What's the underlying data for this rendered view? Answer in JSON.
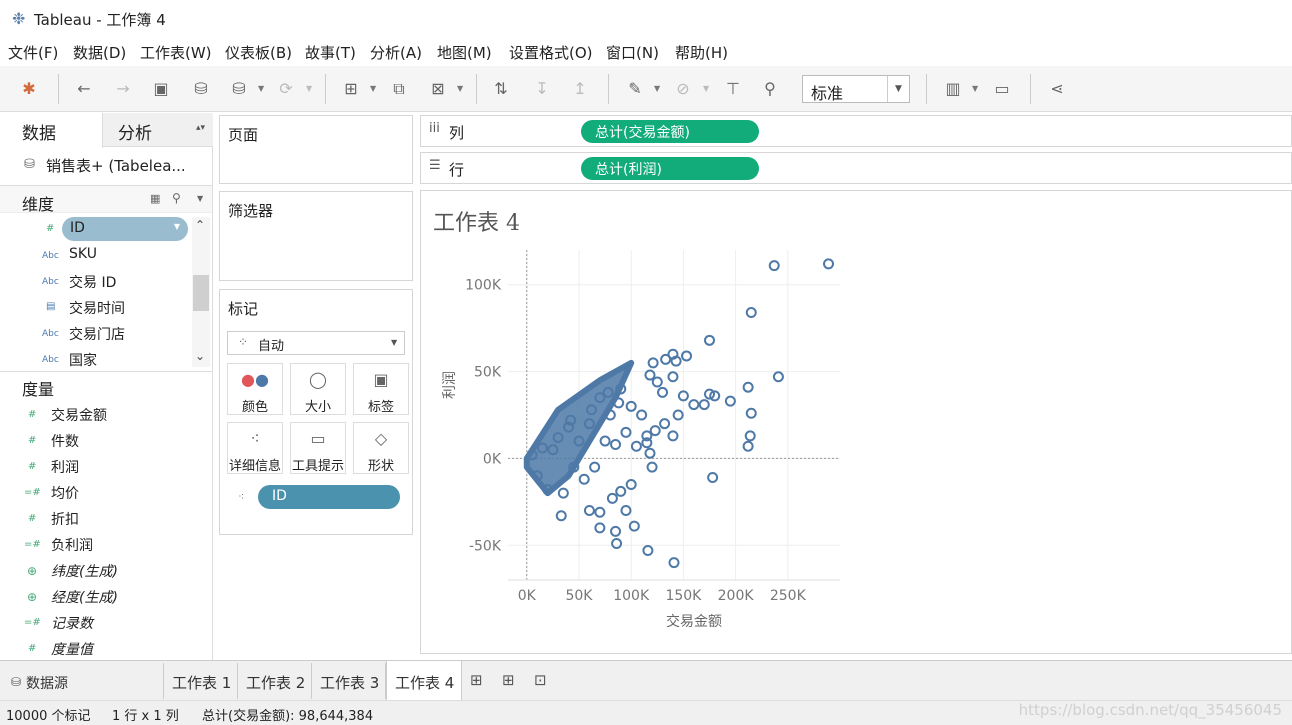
{
  "window": {
    "title": "Tableau - 工作簿 4"
  },
  "menu": [
    "文件(F)",
    "数据(D)",
    "工作表(W)",
    "仪表板(B)",
    "故事(T)",
    "分析(A)",
    "地图(M)",
    "设置格式(O)",
    "窗口(N)",
    "帮助(H)"
  ],
  "toolbar": {
    "icons": [
      "tableau-logo-icon",
      "undo-icon",
      "redo-icon",
      "save-icon",
      "new-datasource-icon",
      "pause-updates-icon",
      "refresh-icon",
      "new-worksheet-icon",
      "duplicate-icon",
      "clear-icon",
      "swap-icon",
      "sort-asc-icon",
      "sort-desc-icon",
      "highlight-icon",
      "group-icon",
      "label-icon",
      "pin-icon",
      "show-me-icon",
      "presentation-icon",
      "share-icon"
    ],
    "fit_value": "标准"
  },
  "left_pane": {
    "tab_data": "数据",
    "tab_analysis": "分析",
    "datasource": "销售表+ (Tabelea...",
    "dimensions_title": "维度",
    "dimensions": [
      {
        "label": "ID",
        "type": "#"
      },
      {
        "label": "SKU",
        "type": "Abc"
      },
      {
        "label": "交易 ID",
        "type": "Abc"
      },
      {
        "label": "交易时间",
        "type": "date"
      },
      {
        "label": "交易门店",
        "type": "Abc"
      },
      {
        "label": "国家",
        "type": "Abc"
      }
    ],
    "measures_title": "度量",
    "measures": [
      {
        "label": "交易金额",
        "type": "#"
      },
      {
        "label": "件数",
        "type": "#"
      },
      {
        "label": "利润",
        "type": "#"
      },
      {
        "label": "均价",
        "type": "=#"
      },
      {
        "label": "折扣",
        "type": "#"
      },
      {
        "label": "负利润",
        "type": "=#"
      },
      {
        "label": "纬度(生成)",
        "type": "geo"
      },
      {
        "label": "经度(生成)",
        "type": "geo"
      },
      {
        "label": "记录数",
        "type": "=#"
      },
      {
        "label": "度量值",
        "type": "#"
      }
    ]
  },
  "shelves": {
    "pages": "页面",
    "filters": "筛选器",
    "marks": "标记",
    "mark_type": "自动",
    "mark_buttons": [
      {
        "label": "颜色",
        "icon": "color-icon"
      },
      {
        "label": "大小",
        "icon": "size-icon"
      },
      {
        "label": "标签",
        "icon": "label-icon"
      },
      {
        "label": "详细信息",
        "icon": "detail-icon"
      },
      {
        "label": "工具提示",
        "icon": "tooltip-icon"
      },
      {
        "label": "形状",
        "icon": "shape-icon"
      }
    ],
    "mark_pill": "ID",
    "columns_label": "列",
    "columns_pill": "总计(交易金额)",
    "rows_label": "行",
    "rows_pill": "总计(利润)"
  },
  "viz": {
    "title": "工作表 4"
  },
  "chart_data": {
    "type": "scatter",
    "xlabel": "交易金额",
    "ylabel": "利润",
    "xlim": [
      -18000,
      300000
    ],
    "ylim": [
      -70000,
      120000
    ],
    "x_ticks": [
      "0K",
      "50K",
      "100K",
      "150K",
      "200K",
      "250K"
    ],
    "y_ticks": [
      "-50K",
      "0K",
      "50K",
      "100K"
    ],
    "grid": true,
    "color": "#4e79a7",
    "points": [
      [
        237000,
        111000
      ],
      [
        289000,
        112000
      ],
      [
        215000,
        84000
      ],
      [
        175000,
        68000
      ],
      [
        241000,
        47000
      ],
      [
        212000,
        41000
      ],
      [
        215000,
        26000
      ],
      [
        214000,
        13000
      ],
      [
        212000,
        7000
      ],
      [
        175000,
        37000
      ],
      [
        180000,
        36000
      ],
      [
        195000,
        33000
      ],
      [
        160000,
        31000
      ],
      [
        170000,
        31000
      ],
      [
        140000,
        60000
      ],
      [
        153000,
        59000
      ],
      [
        133000,
        57000
      ],
      [
        143000,
        56000
      ],
      [
        121000,
        55000
      ],
      [
        118000,
        48000
      ],
      [
        125000,
        44000
      ],
      [
        140000,
        47000
      ],
      [
        130000,
        38000
      ],
      [
        150000,
        36000
      ],
      [
        145000,
        25000
      ],
      [
        132000,
        20000
      ],
      [
        140000,
        13000
      ],
      [
        123000,
        16000
      ],
      [
        115000,
        13000
      ],
      [
        115000,
        9000
      ],
      [
        118000,
        3000
      ],
      [
        105000,
        7000
      ],
      [
        120000,
        -5000
      ],
      [
        178000,
        -11000
      ],
      [
        90000,
        -19000
      ],
      [
        95000,
        -30000
      ],
      [
        82000,
        -23000
      ],
      [
        70000,
        -31000
      ],
      [
        103000,
        -39000
      ],
      [
        85000,
        -42000
      ],
      [
        86000,
        -49000
      ],
      [
        116000,
        -53000
      ],
      [
        141000,
        -60000
      ],
      [
        33000,
        -33000
      ],
      [
        10000,
        -10000
      ],
      [
        20000,
        -18000
      ],
      [
        60000,
        -30000
      ],
      [
        70000,
        -40000
      ],
      [
        50000,
        10000
      ],
      [
        60000,
        20000
      ],
      [
        80000,
        25000
      ],
      [
        100000,
        30000
      ],
      [
        90000,
        40000
      ],
      [
        70000,
        35000
      ],
      [
        40000,
        18000
      ],
      [
        30000,
        12000
      ],
      [
        15000,
        6000
      ],
      [
        5000,
        2000
      ],
      [
        25000,
        5000
      ],
      [
        45000,
        -5000
      ],
      [
        55000,
        -12000
      ],
      [
        35000,
        -20000
      ],
      [
        65000,
        -5000
      ],
      [
        75000,
        10000
      ],
      [
        95000,
        15000
      ],
      [
        110000,
        25000
      ],
      [
        85000,
        8000
      ],
      [
        100000,
        -15000
      ],
      [
        62000,
        28000
      ],
      [
        78000,
        38000
      ],
      [
        42000,
        22000
      ],
      [
        88000,
        32000
      ]
    ]
  },
  "bottom": {
    "datasource_tab": "数据源",
    "sheets": [
      "工作表 1",
      "工作表 2",
      "工作表 3",
      "工作表 4"
    ]
  },
  "status": {
    "marks": "10000 个标记",
    "rowcol": "1 行 x 1 列",
    "sum": "总计(交易金额): 98,644,384",
    "watermark": "https://blog.csdn.net/qq_35456045"
  }
}
